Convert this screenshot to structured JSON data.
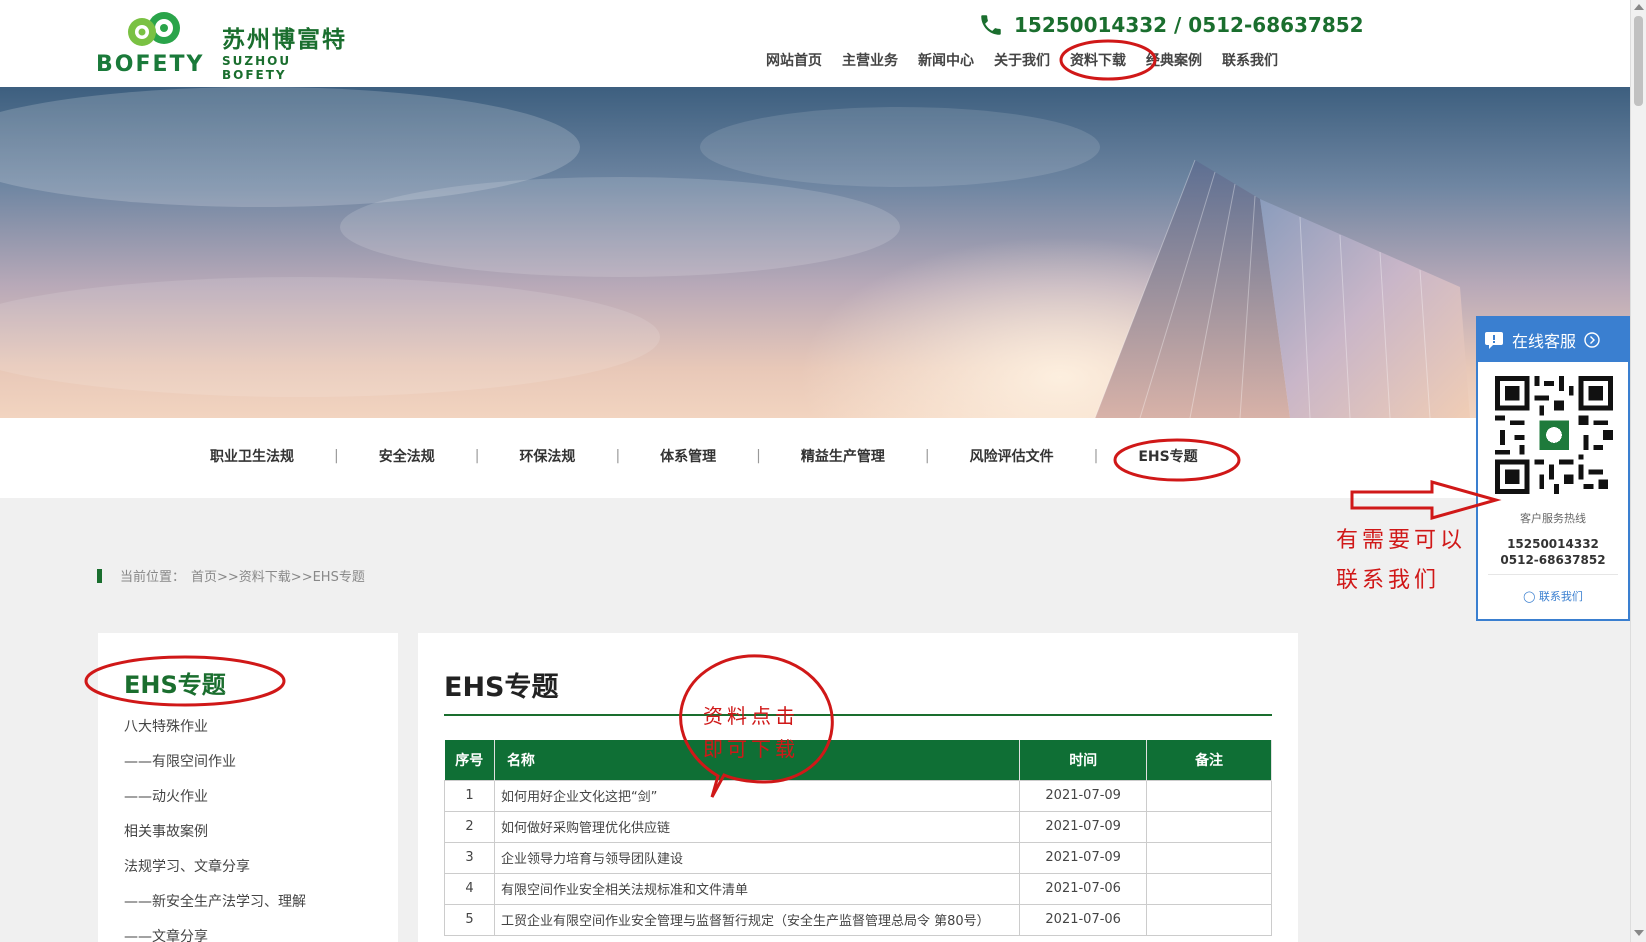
{
  "header": {
    "logo_cn": "苏州博富特",
    "logo_en": "BOFETY",
    "logo_sub": "SUZHOU BOFETY",
    "phone": "15250014332 / 0512-68637852",
    "nav": [
      "网站首页",
      "主营业务",
      "新闻中心",
      "关于我们",
      "资料下载",
      "经典案例",
      "联系我们"
    ],
    "active_nav": "资料下载"
  },
  "subnav": {
    "items": [
      "职业卫生法规",
      "安全法规",
      "环保法规",
      "体系管理",
      "精益生产管理",
      "风险评估文件",
      "EHS专题"
    ],
    "separator": "|",
    "active": "EHS专题"
  },
  "breadcrumb": {
    "prefix": "当前位置：",
    "path": "首页>>资料下载>>EHS专题"
  },
  "sidebar": {
    "title": "EHS专题",
    "items": [
      "八大特殊作业",
      "——有限空间作业",
      "——动火作业",
      "相关事故案例",
      "法规学习、文章分享",
      "——新安全生产法学习、理解",
      "——文章分享"
    ]
  },
  "main": {
    "title": "EHS专题",
    "columns": [
      "序号",
      "名称",
      "时间",
      "备注"
    ],
    "rows": [
      {
        "num": "1",
        "name": "如何用好企业文化这把“剑”",
        "date": "2021-07-09",
        "note": ""
      },
      {
        "num": "2",
        "name": "如何做好采购管理优化供应链",
        "date": "2021-07-09",
        "note": ""
      },
      {
        "num": "3",
        "name": "企业领导力培育与领导团队建设",
        "date": "2021-07-09",
        "note": ""
      },
      {
        "num": "4",
        "name": "有限空间作业安全相关法规标准和文件清单",
        "date": "2021-07-06",
        "note": ""
      },
      {
        "num": "5",
        "name": "工贸企业有限空间作业安全管理与监督暂行规定（安全生产监督管理总局令 第80号）",
        "date": "2021-07-06",
        "note": ""
      }
    ]
  },
  "service": {
    "title": "在线客服",
    "hotline_label": "客户服务热线",
    "phone1": "15250014332",
    "phone2": "0512-68637852",
    "link": "联系我们"
  },
  "annotations": {
    "contact_line1": "有需要可以",
    "contact_line2": "联系我们",
    "download_line1": "资料点击",
    "download_line2": "即可下载"
  },
  "colors": {
    "brand_green": "#0f6f35",
    "service_blue": "#3a7fd0",
    "annotation_red": "#d01818"
  }
}
